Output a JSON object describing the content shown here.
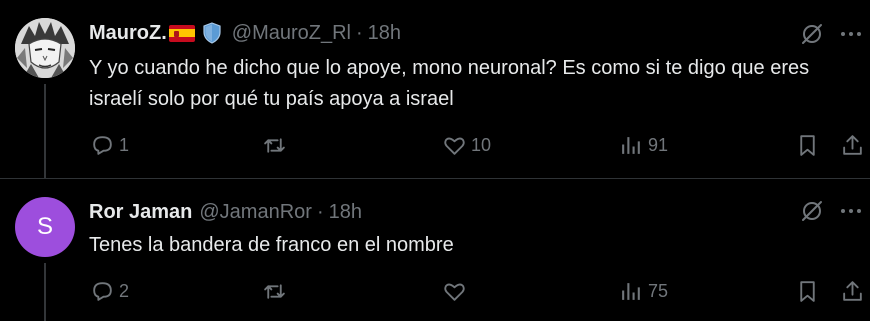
{
  "tweets": [
    {
      "author": {
        "name": "MauroZ.",
        "handle": "@MauroZ_Rl",
        "time": "18h",
        "avatar": "manga-portrait-avatar",
        "badges": [
          "spain-flag-emoji",
          "blue-shield-emoji"
        ]
      },
      "text": "Y yo cuando he dicho que lo apoye, mono neuronal? Es como si te digo que eres israelí solo por qué tu país apoya a israel",
      "stats": {
        "replies": "1",
        "retweets": "",
        "likes": "10",
        "views": "91"
      }
    },
    {
      "author": {
        "name": "Ror Jaman",
        "handle": "@JamanRor",
        "time": "18h",
        "avatar_letter": "S",
        "avatar_color": "#9d4edd"
      },
      "text": "Tenes la bandera de franco en el nombre",
      "stats": {
        "replies": "2",
        "retweets": "",
        "likes": "",
        "views": "75"
      }
    }
  ],
  "separator_symbol": "·",
  "colors": {
    "background": "#000000",
    "text": "#e7e9ea",
    "muted": "#71767b",
    "border": "#2f3336",
    "shield": "#5b9bd5"
  },
  "icons": [
    "grok-icon",
    "more-icon",
    "reply-icon",
    "retweet-icon",
    "like-icon",
    "views-icon",
    "bookmark-icon",
    "share-icon"
  ]
}
